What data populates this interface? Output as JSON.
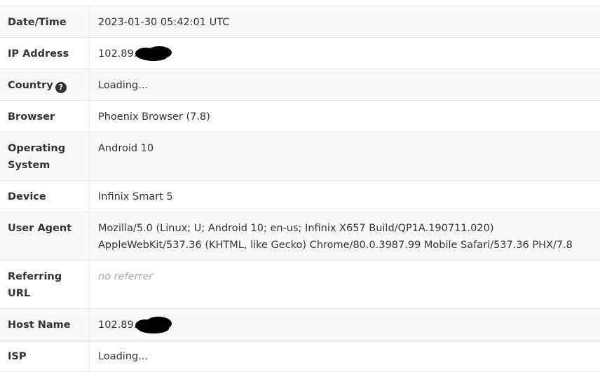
{
  "rows": [
    {
      "label": "Date/Time",
      "value": "2023-01-30 05:42:01 UTC"
    },
    {
      "label": "IP Address",
      "value": "102.89."
    },
    {
      "label": "Country",
      "value": "Loading...",
      "help_icon": "question-circle-icon"
    },
    {
      "label": "Browser",
      "value": "Phoenix Browser (7.8)"
    },
    {
      "label": "Operating System",
      "value": "Android 10"
    },
    {
      "label": "Device",
      "value": "Infinix Smart 5"
    },
    {
      "label": "User Agent",
      "value": "Mozilla/5.0 (Linux; U; Android 10; en-us; Infinix X657 Build/QP1A.190711.020) AppleWebKit/537.36 (KHTML, like Gecko) Chrome/80.0.3987.99 Mobile Safari/537.36 PHX/7.8"
    },
    {
      "label": "Referring URL",
      "value": "no referrer"
    },
    {
      "label": "Host Name",
      "value": "102.89."
    },
    {
      "label": "ISP",
      "value": "Loading..."
    }
  ],
  "help_glyph": "?",
  "colors": {
    "row_stripe": "#f9f9f9",
    "border": "#e6e6e6",
    "text": "#333333",
    "muted": "#a8a8a8",
    "redaction": "#000000"
  }
}
